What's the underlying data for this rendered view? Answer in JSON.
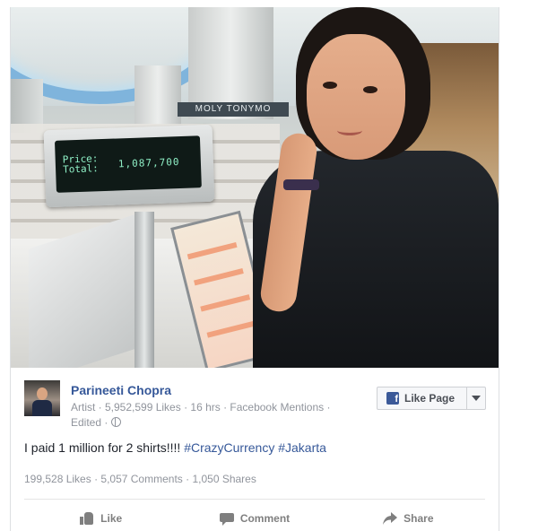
{
  "post": {
    "author": "Parineeti Chopra",
    "meta_line": "Artist · 5,952,599 Likes · 16 hrs · Facebook Mentions ·",
    "meta_edited": "Edited ·",
    "text_main": "I paid 1 million for 2 shirts!!!! ",
    "hashtag_1": "#CrazyCurrency",
    "hashtag_2": "#Jakarta",
    "like_page_label": "Like Page"
  },
  "photo": {
    "display_price_label": "Price:",
    "display_total_label": "Total:",
    "display_amount": "1,087,700",
    "shop_sign": "MOLY TONYMO"
  },
  "stats": {
    "likes": "199,528 Likes",
    "comments": "5,057 Comments",
    "shares": "1,050 Shares",
    "separator": " · "
  },
  "actions": {
    "like": "Like",
    "comment": "Comment",
    "share": "Share"
  },
  "colors": {
    "link_blue": "#365899",
    "facebook_blue": "#3b5998",
    "meta_grey": "#90949c"
  }
}
